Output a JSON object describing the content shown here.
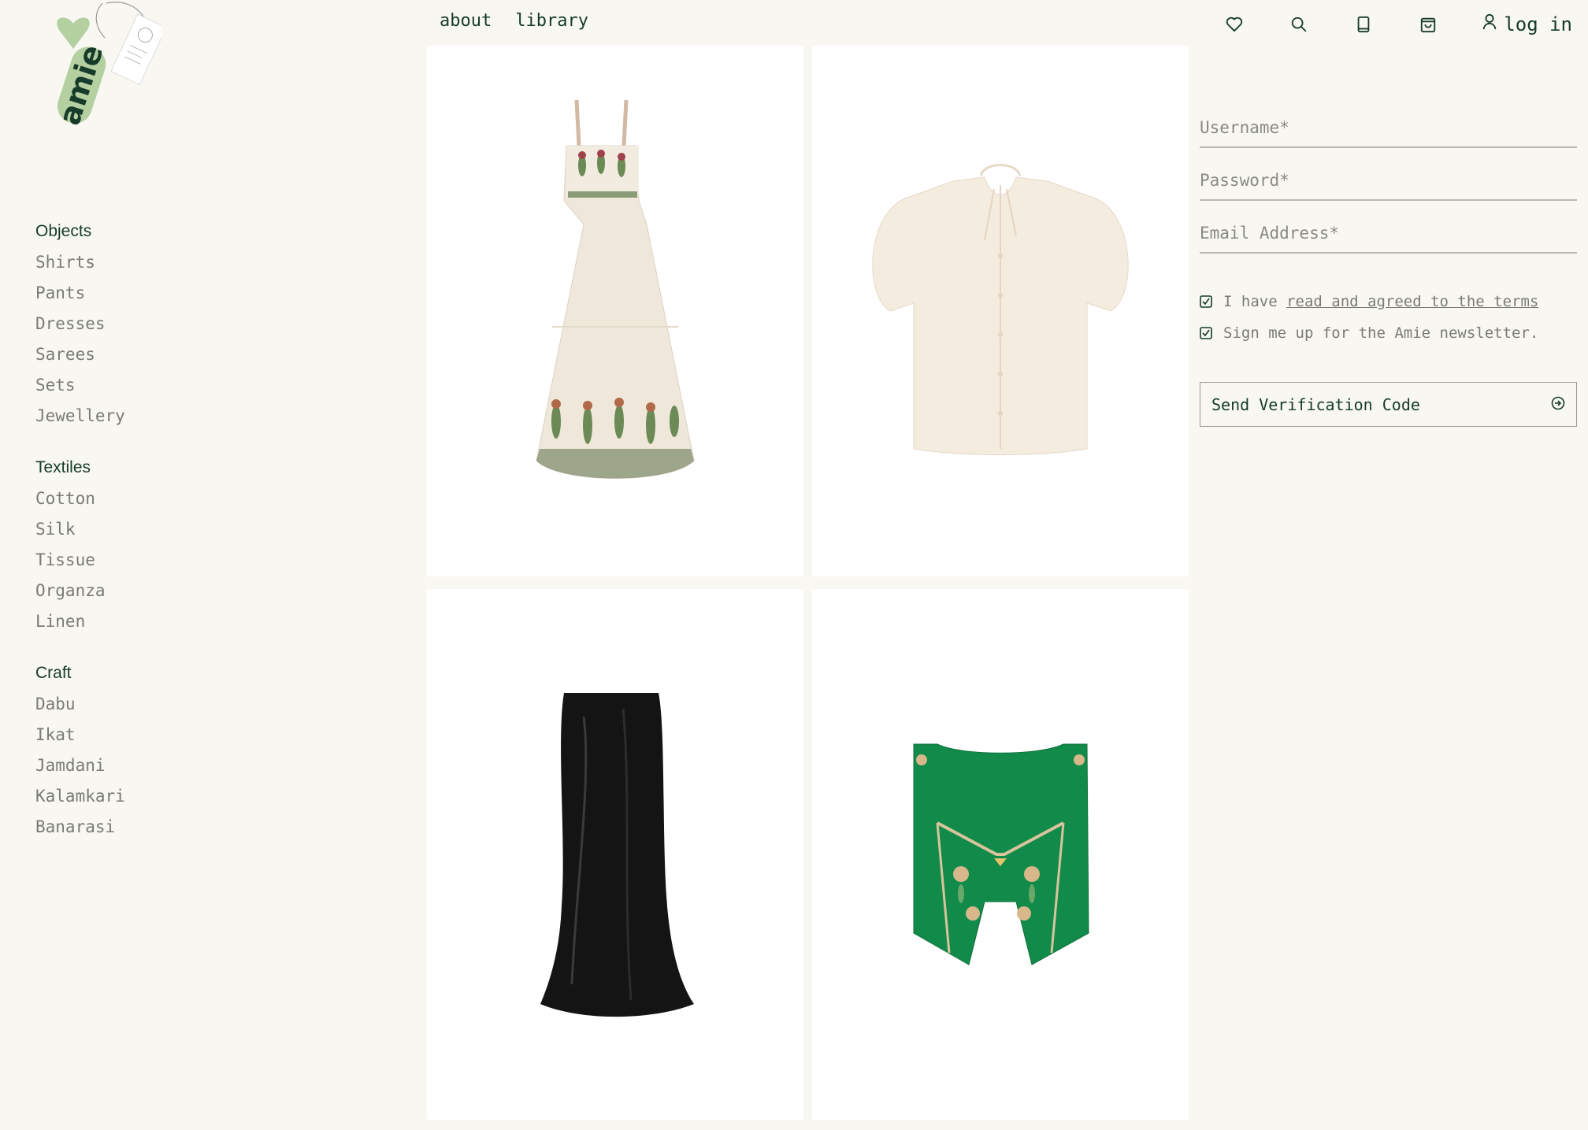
{
  "brand": {
    "logo_text": "amie"
  },
  "nav": {
    "about": "about",
    "library": "library"
  },
  "header": {
    "login_label": "log in"
  },
  "sidebar": {
    "groups": [
      {
        "heading": "Objects",
        "items": [
          "Shirts",
          "Pants",
          "Dresses",
          "Sarees",
          "Sets",
          "Jewellery"
        ]
      },
      {
        "heading": "Textiles",
        "items": [
          "Cotton",
          "Silk",
          "Tissue",
          "Organza",
          "Linen"
        ]
      },
      {
        "heading": "Craft",
        "items": [
          "Dabu",
          "Ikat",
          "Jamdani",
          "Kalamkari",
          "Banarasi"
        ]
      }
    ]
  },
  "form": {
    "username_placeholder": "Username*",
    "password_placeholder": "Password*",
    "email_placeholder": "Email Address*",
    "terms_prefix": "I have ",
    "terms_link": "read and agreed to the terms",
    "newsletter": "Sign me up for the Amie newsletter.",
    "send_button": "Send Verification Code"
  },
  "icons": [
    "heart-icon",
    "search-icon",
    "book-icon",
    "bag-icon",
    "user-icon",
    "checkbox-icon",
    "arrow-circle-right-icon"
  ],
  "colors": {
    "background": "#f8f7f2",
    "text": "#163b2a",
    "muted": "#7b7b76",
    "card": "#ffffff",
    "vest": "#128a4a"
  }
}
